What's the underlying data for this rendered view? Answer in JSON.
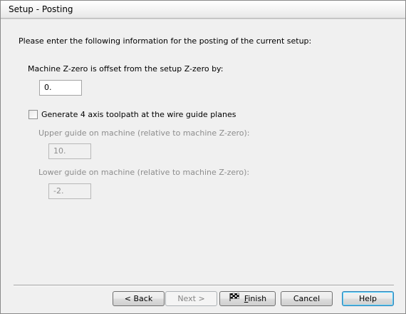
{
  "window": {
    "title": "Setup - Posting"
  },
  "intro": "Please enter the following information for the posting of the current setup:",
  "zero_offset": {
    "label": "Machine Z-zero is offset from the setup Z-zero by:",
    "value": "0."
  },
  "four_axis": {
    "label": "Generate 4 axis toolpath at the wire guide planes",
    "checked": false
  },
  "upper_guide": {
    "label": "Upper guide on machine (relative to machine Z-zero):",
    "value": "10."
  },
  "lower_guide": {
    "label": "Lower guide on machine (relative to machine Z-zero):",
    "value": "-2."
  },
  "buttons": {
    "back": "< Back",
    "next": "Next >",
    "finish_first": "F",
    "finish_rest": "inish",
    "cancel": "Cancel",
    "help": "Help"
  },
  "icons": {
    "finish": "checkered-flag-icon"
  },
  "colors": {
    "disabled_text": "#8d8d8d",
    "default_button_border": "#3c7fb1"
  }
}
